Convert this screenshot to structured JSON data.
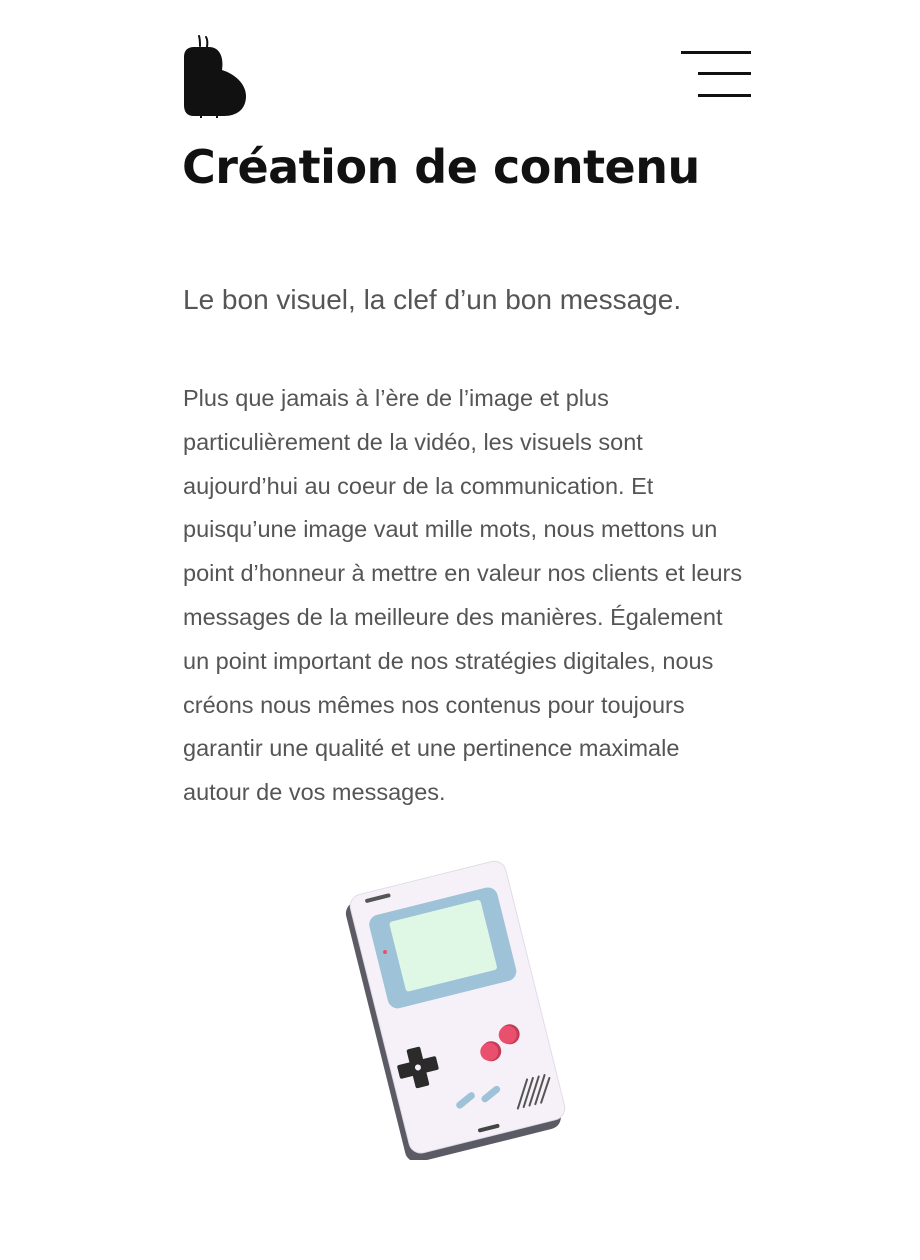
{
  "header": {
    "logo_icon": "pear-logo-icon",
    "menu_icon": "hamburger-menu-icon"
  },
  "main": {
    "title": "Création de contenu",
    "subtitle": "Le bon visuel, la clef d’un bon message.",
    "body": "Plus que jamais à l’ère de l’image et plus particulièrement de la vidéo, les visuels sont aujourd’hui au coeur de la communication. Et puisqu’une image vaut mille mots, nous mettons un point d’honneur à mettre en valeur nos clients et leurs messages de la meilleure des manières. Également un point important de nos stratégies digitales, nous créons nous mêmes nos contenus pour toujours garantir une qualité et une pertinence maximale autour de vos messages."
  },
  "illustration": {
    "icon": "handheld-console-illustration",
    "colors": {
      "body": "#f6f1f8",
      "side": "#5b5b66",
      "screen_frame": "#9ec2d8",
      "screen": "#dff8e6",
      "dpad": "#2b2b2b",
      "buttons": "#e8506e",
      "select_start": "#9ec2d8"
    }
  }
}
